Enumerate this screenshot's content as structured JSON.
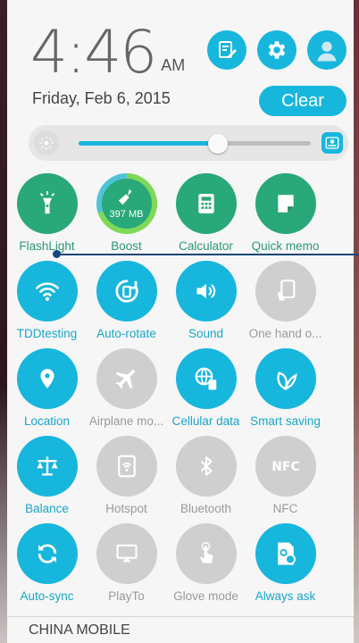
{
  "header": {
    "time": "4:46",
    "ampm": "AM",
    "date": "Friday, Feb 6, 2015",
    "clear_label": "Clear",
    "buttons": [
      {
        "name": "edit-tiles-button",
        "icon": "edit-list-icon"
      },
      {
        "name": "settings-button",
        "icon": "gear-icon"
      },
      {
        "name": "user-avatar-button",
        "icon": "user-avatar-icon"
      }
    ]
  },
  "brightness": {
    "level": 0.6,
    "auto_icon": "auto-brightness-icon",
    "low_icon": "brightness-low-icon"
  },
  "tiles": [
    {
      "label": "FlashLight",
      "state": "active",
      "icon": "flashlight-icon"
    },
    {
      "label": "Boost",
      "state": "active",
      "icon": "broom-icon",
      "value": "397 MB"
    },
    {
      "label": "Calculator",
      "state": "active",
      "icon": "calculator-icon"
    },
    {
      "label": "Quick memo",
      "state": "active",
      "icon": "memo-icon"
    },
    {
      "label": "TDDtesting",
      "state": "on",
      "icon": "wifi-icon"
    },
    {
      "label": "Auto-rotate",
      "state": "on",
      "icon": "rotate-icon"
    },
    {
      "label": "Sound",
      "state": "on",
      "icon": "volume-icon"
    },
    {
      "label": "One hand o...",
      "state": "off",
      "icon": "one-hand-icon"
    },
    {
      "label": "Location",
      "state": "on",
      "icon": "location-pin-icon"
    },
    {
      "label": "Airplane mo...",
      "state": "off",
      "icon": "airplane-icon"
    },
    {
      "label": "Cellular data",
      "state": "on",
      "icon": "cellular-data-icon"
    },
    {
      "label": "Smart saving",
      "state": "on",
      "icon": "leaf-icon"
    },
    {
      "label": "Balance",
      "state": "on",
      "icon": "balance-scale-icon"
    },
    {
      "label": "Hotspot",
      "state": "off",
      "icon": "hotspot-icon"
    },
    {
      "label": "Bluetooth",
      "state": "off",
      "icon": "bluetooth-icon"
    },
    {
      "label": "NFC",
      "state": "off",
      "icon": "nfc-icon"
    },
    {
      "label": "Auto-sync",
      "state": "on",
      "icon": "sync-icon"
    },
    {
      "label": "PlayTo",
      "state": "off",
      "icon": "cast-icon"
    },
    {
      "label": "Glove mode",
      "state": "off",
      "icon": "glove-touch-icon"
    },
    {
      "label": "Always ask",
      "state": "on",
      "icon": "sim-settings-icon"
    }
  ],
  "colors": {
    "accent": "#17b6dd",
    "active_green": "#29a87a",
    "off_gray": "#cfcfcf",
    "label_on": "#17a6c9",
    "label_off": "#9a9a9a"
  },
  "footer": {
    "carrier": "CHINA MOBILE"
  }
}
